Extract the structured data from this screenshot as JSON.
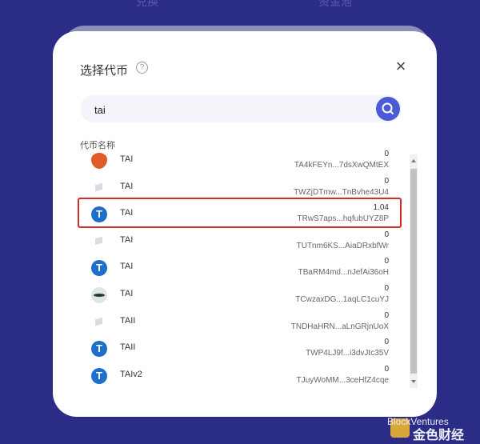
{
  "background_tabs": [
    "兑换",
    "资金池"
  ],
  "modal": {
    "title": "选择代币",
    "help_icon": "question-circle-icon",
    "close_icon": "close-icon"
  },
  "search": {
    "value": "tai",
    "placeholder": "",
    "button_icon": "search-icon"
  },
  "list": {
    "column_header": "代币名称",
    "tokens": [
      {
        "name": "TAI",
        "balance": "0",
        "address": "TA4kFEYn...7dsXwQMtEX",
        "icon": "shield-icon"
      },
      {
        "name": "TAI",
        "balance": "0",
        "address": "TWZjDTmw...TnBvhe43U4",
        "icon": "box-icon"
      },
      {
        "name": "TAI",
        "balance": "1.04",
        "address": "TRwS7aps...hqfubUYZ8P",
        "icon": "tether-icon"
      },
      {
        "name": "TAI",
        "balance": "0",
        "address": "TUTnm6KS...AiaDRxbfWr",
        "icon": "box-icon"
      },
      {
        "name": "TAI",
        "balance": "0",
        "address": "TBaRM4md...nJefAi36oH",
        "icon": "tether-icon"
      },
      {
        "name": "TAI",
        "balance": "0",
        "address": "TCwzaxDG...1aqLC1cuYJ",
        "icon": "eye-icon"
      },
      {
        "name": "TAII",
        "balance": "0",
        "address": "TNDHaHRN...aLnGRjnUoX",
        "icon": "box-icon"
      },
      {
        "name": "TAII",
        "balance": "0",
        "address": "TWP4LJ9f...i3dvJtc35V",
        "icon": "tether-icon"
      },
      {
        "name": "TAIv2",
        "balance": "0",
        "address": "TJuyWoMM...3ceHfZ4cqe",
        "icon": "tether-icon"
      }
    ]
  },
  "watermark": {
    "line1": "BlockVentures",
    "line2": "金色财经"
  },
  "colors": {
    "background": "#2b2c86",
    "accent": "#4b5bd6",
    "highlight": "#d42b2b"
  }
}
